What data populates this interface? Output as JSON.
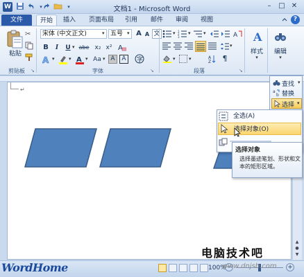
{
  "window": {
    "app_icon": "W",
    "title": "文档1 - Microsoft Word",
    "minimize_glyph": "–",
    "maximize_glyph": "□",
    "close_glyph": "✕"
  },
  "quick_access": {
    "save_icon": "save-icon",
    "undo_icon": "undo-icon",
    "redo_icon": "redo-icon",
    "open_icon": "folder-icon"
  },
  "tabs": {
    "file": "文件",
    "items": [
      "开始",
      "插入",
      "页面布局",
      "引用",
      "邮件",
      "审阅",
      "视图"
    ],
    "active": "开始"
  },
  "ribbon": {
    "clipboard": {
      "paste_label": "粘贴",
      "group_label": "剪贴板"
    },
    "font": {
      "font_name": "宋体 (中文正文)",
      "font_size": "五号",
      "wen_label": "文",
      "group_label": "字体",
      "bold": "B",
      "italic": "I",
      "underline": "U",
      "strike": "abe",
      "subscript": "x₂",
      "superscript": "x²",
      "font_color": "A",
      "aa_label": "Aa",
      "char_a": "A"
    },
    "paragraph": {
      "group_label": "段落"
    },
    "styles": {
      "label": "样式",
      "icon_char": "A"
    },
    "editing": {
      "label": "编辑",
      "icon_char": "A",
      "find_label": "查找",
      "replace_label": "替换",
      "select_label": "选择"
    }
  },
  "select_menu": {
    "items": [
      {
        "label": "全选(A)",
        "icon": "select-all-icon"
      },
      {
        "label": "选择对象(O)",
        "icon": "arrow-cursor-icon",
        "highlighted": true
      },
      {
        "label": "",
        "icon": "select-similar-icon"
      }
    ]
  },
  "tooltip": {
    "title": "选择对象",
    "body": "选择墨迹笔划、形状和文本的矩形区域。"
  },
  "document": {
    "shapes": [
      "parallelogram",
      "parallelogram",
      "parallelogram"
    ]
  },
  "statusbar": {
    "zoom": "100%"
  },
  "watermarks": {
    "left": "WordHome",
    "right": "电脑技术吧",
    "url": "www.dnjsb.com"
  },
  "colors": {
    "file_tab": "#2a5aa8",
    "shape_fill": "#4f81bd",
    "shape_border": "#385d8a",
    "highlight": "#fbd56f"
  }
}
